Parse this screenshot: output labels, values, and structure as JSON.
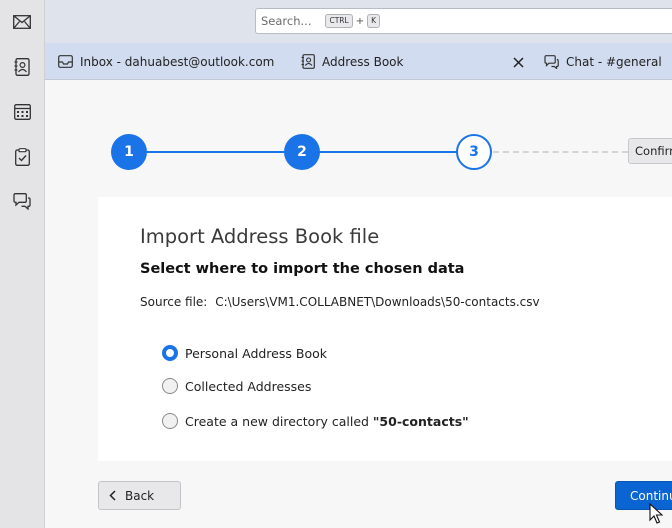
{
  "search": {
    "placeholder": "Search...",
    "key1": "CTRL",
    "plus": "+",
    "key2": "K"
  },
  "tabs": [
    {
      "label": "Inbox - dahuabest@outlook.com",
      "icon": "mail-tray-icon"
    },
    {
      "label": "Address Book",
      "icon": "address-book-icon"
    },
    {
      "label": "Chat - #general",
      "icon": "chat-icon"
    }
  ],
  "spaces": [
    "mail-icon",
    "address-book-icon",
    "calendar-icon",
    "tasks-icon",
    "chat-icon"
  ],
  "wizard": {
    "steps": [
      "1",
      "2",
      "3"
    ],
    "confirm_label": "Confirm",
    "title": "Import Address Book file",
    "subtitle": "Select where to import the chosen data",
    "source_label": "Source file:",
    "source_path": "C:\\Users\\VM1.COLLABNET\\Downloads\\50-contacts.csv",
    "options": [
      {
        "label": "Personal Address Book",
        "checked": true
      },
      {
        "label": "Collected Addresses",
        "checked": false
      },
      {
        "label_prefix": "Create a new directory called ",
        "label_bold": "\"50-contacts\"",
        "checked": false
      }
    ],
    "back_label": "Back",
    "continue_label": "Continue"
  },
  "colors": {
    "accent": "#1b73e8",
    "primary_button": "#0a64d2"
  }
}
